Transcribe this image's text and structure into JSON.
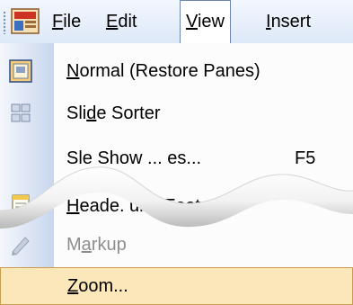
{
  "menubar": {
    "app_icon": "powerpoint-app-icon",
    "items": [
      {
        "accel": "F",
        "rest": "ile"
      },
      {
        "accel": "E",
        "rest": "dit"
      },
      {
        "accel": "V",
        "rest": "iew",
        "active": true
      },
      {
        "accel": "I",
        "rest": "nsert"
      }
    ]
  },
  "dropdown": {
    "items": [
      {
        "pre": "",
        "accel": "N",
        "post": "ormal (Restore Panes)",
        "icon": "normal-view-icon"
      },
      {
        "pre": "Sli",
        "accel": "d",
        "post": "e Sorter",
        "icon": "slide-sorter-icon"
      },
      {
        "pre": "S",
        "accel": "",
        "post": "le Show ... es...",
        "shortcut": "F5",
        "icon": "slide-show-icon"
      },
      {
        "pre": "",
        "accel": "H",
        "post": "eade. und Footer...",
        "icon": "header-footer-icon"
      },
      {
        "pre": "M",
        "accel": "a",
        "post": "rkup",
        "icon": "markup-icon",
        "disabled": true
      },
      {
        "pre": "",
        "accel": "Z",
        "post": "oom...",
        "highlighted": true
      }
    ]
  },
  "colors": {
    "menubar": "#dde8f8",
    "gutter": "#c8d6ee",
    "highlight": "#fbe7ba",
    "highlight_border": "#c99d4c",
    "disabled_text": "#8d8d8d"
  }
}
